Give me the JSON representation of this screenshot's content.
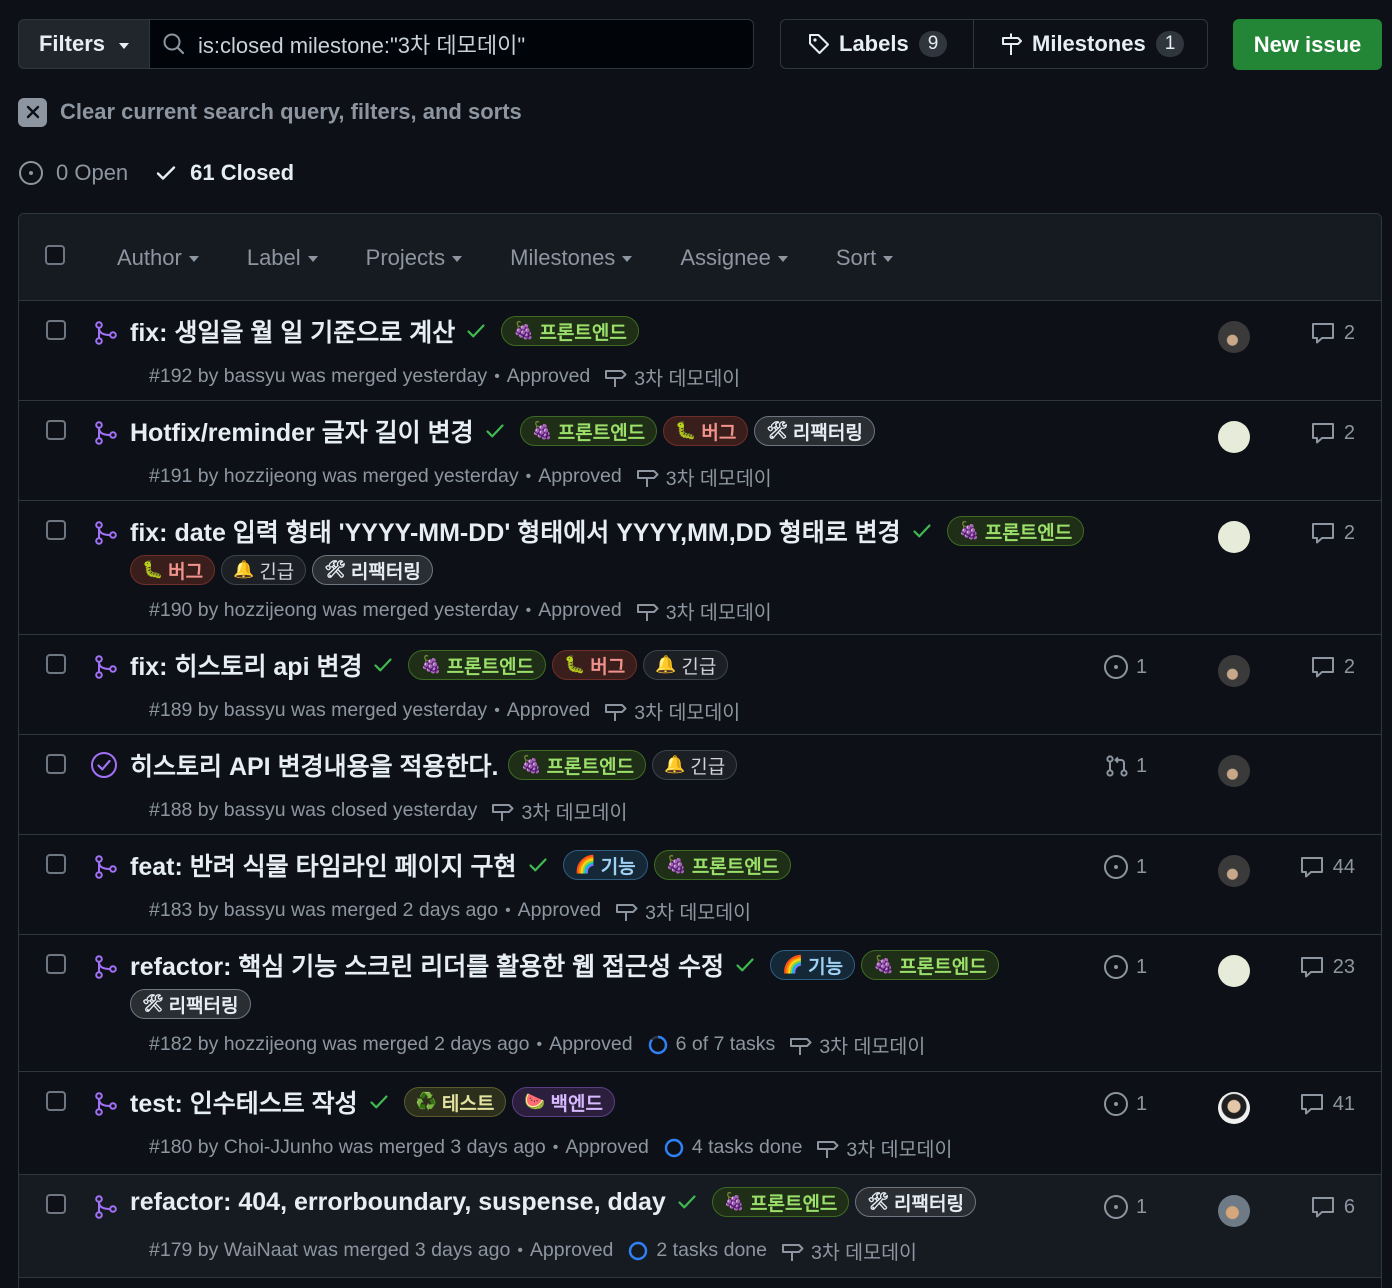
{
  "toolbar": {
    "filters_label": "Filters",
    "search_value": "is:closed milestone:\"3차 데모데이\"",
    "labels_label": "Labels",
    "labels_count": "9",
    "milestones_label": "Milestones",
    "milestones_count": "1",
    "new_issue_label": "New issue"
  },
  "clear_query_label": "Clear current search query, filters, and sorts",
  "states": {
    "open": "0 Open",
    "closed": "61 Closed"
  },
  "header_filters": [
    "Author",
    "Label",
    "Projects",
    "Milestones",
    "Assignee",
    "Sort"
  ],
  "colors": {
    "merged": "#a371f7",
    "accent_green": "#238636",
    "check_green": "#3fb950",
    "task_blue": "#2f81f7"
  },
  "items": [
    {
      "title": "fix: 생일을 월 일 기준으로 계산",
      "check": true,
      "labels": [
        {
          "emoji": "🍇",
          "text": "프론트엔드",
          "kind": "frontend"
        }
      ],
      "meta": "#192 by bassyu was merged yesterday",
      "review": "Approved",
      "tasks": "",
      "milestone": "3차 데모데이",
      "linked": "",
      "comments": "2",
      "icon": "merged-pr-icon",
      "avatar": "dark"
    },
    {
      "title": "Hotfix/reminder 글자 길이 변경",
      "check": true,
      "labels": [
        {
          "emoji": "🍇",
          "text": "프론트엔드",
          "kind": "frontend"
        },
        {
          "emoji": "🐛",
          "text": "버그",
          "kind": "bug"
        },
        {
          "emoji": "🛠",
          "text": "리팩터링",
          "kind": "refactor"
        }
      ],
      "meta": "#191 by hozzijeong was merged yesterday",
      "review": "Approved",
      "tasks": "",
      "milestone": "3차 데모데이",
      "linked": "",
      "comments": "2",
      "icon": "merged-pr-icon",
      "avatar": "identicon"
    },
    {
      "title": "fix: date 입력 형태 'YYYY-MM-DD' 형태에서 YYYY,MM,DD 형태로 변경",
      "check": true,
      "labels": [
        {
          "emoji": "🍇",
          "text": "프론트엔드",
          "kind": "frontend"
        },
        {
          "emoji": "🐛",
          "text": "버그",
          "kind": "bug"
        },
        {
          "emoji": "🔔",
          "text": "긴급",
          "kind": "urgent"
        },
        {
          "emoji": "🛠",
          "text": "리팩터링",
          "kind": "refactor"
        }
      ],
      "meta": "#190 by hozzijeong was merged yesterday",
      "review": "Approved",
      "tasks": "",
      "milestone": "3차 데모데이",
      "linked": "",
      "comments": "2",
      "icon": "merged-pr-icon",
      "avatar": "identicon"
    },
    {
      "title": "fix: 히스토리 api 변경",
      "check": true,
      "labels": [
        {
          "emoji": "🍇",
          "text": "프론트엔드",
          "kind": "frontend"
        },
        {
          "emoji": "🐛",
          "text": "버그",
          "kind": "bug"
        },
        {
          "emoji": "🔔",
          "text": "긴급",
          "kind": "urgent"
        }
      ],
      "meta": "#189 by bassyu was merged yesterday",
      "review": "Approved",
      "tasks": "",
      "milestone": "3차 데모데이",
      "linked": "1",
      "linked_kind": "issue",
      "comments": "2",
      "icon": "merged-pr-icon",
      "avatar": "dark"
    },
    {
      "title": "히스토리 API 변경내용을 적용한다.",
      "check": false,
      "labels": [
        {
          "emoji": "🍇",
          "text": "프론트엔드",
          "kind": "frontend"
        },
        {
          "emoji": "🔔",
          "text": "긴급",
          "kind": "urgent"
        }
      ],
      "meta": "#188 by bassyu was closed yesterday",
      "review": "",
      "tasks": "",
      "milestone": "3차 데모데이",
      "linked": "1",
      "linked_kind": "pr",
      "comments": "",
      "icon": "closed-issue-icon",
      "avatar": "dark"
    },
    {
      "title": "feat: 반려 식물 타임라인 페이지 구현",
      "check": true,
      "labels": [
        {
          "emoji": "🌈",
          "text": "기능",
          "kind": "feature"
        },
        {
          "emoji": "🍇",
          "text": "프론트엔드",
          "kind": "frontend"
        }
      ],
      "meta": "#183 by bassyu was merged 2 days ago",
      "review": "Approved",
      "tasks": "",
      "milestone": "3차 데모데이",
      "linked": "1",
      "linked_kind": "issue",
      "comments": "44",
      "icon": "merged-pr-icon",
      "avatar": "dark"
    },
    {
      "title": "refactor: 핵심 기능 스크린 리더를 활용한 웹 접근성 수정",
      "check": true,
      "labels": [
        {
          "emoji": "🌈",
          "text": "기능",
          "kind": "feature"
        },
        {
          "emoji": "🍇",
          "text": "프론트엔드",
          "kind": "frontend"
        },
        {
          "emoji": "🛠",
          "text": "리팩터링",
          "kind": "refactor"
        }
      ],
      "meta": "#182 by hozzijeong was merged 2 days ago",
      "review": "Approved",
      "tasks": "6 of 7 tasks",
      "tasks_progress": 0.857,
      "milestone": "3차 데모데이",
      "linked": "1",
      "linked_kind": "issue",
      "comments": "23",
      "icon": "merged-pr-icon",
      "avatar": "identicon"
    },
    {
      "title": "test: 인수테스트 작성",
      "check": true,
      "labels": [
        {
          "emoji": "♻️",
          "text": "테스트",
          "kind": "test"
        },
        {
          "emoji": "🍉",
          "text": "백엔드",
          "kind": "backend"
        }
      ],
      "meta": "#180 by Choi-JJunho was merged 3 days ago",
      "review": "Approved",
      "tasks": "4 tasks done",
      "tasks_progress": 1,
      "milestone": "3차 데모데이",
      "linked": "1",
      "linked_kind": "issue",
      "comments": "41",
      "icon": "merged-pr-icon",
      "avatar": "choi"
    },
    {
      "title": "refactor: 404, errorboundary, suspense, dday",
      "check": true,
      "labels": [
        {
          "emoji": "🍇",
          "text": "프론트엔드",
          "kind": "frontend"
        },
        {
          "emoji": "🛠",
          "text": "리팩터링",
          "kind": "refactor"
        }
      ],
      "meta": "#179 by WaiNaat was merged 3 days ago",
      "review": "Approved",
      "tasks": "2 tasks done",
      "tasks_progress": 1,
      "milestone": "3차 데모데이",
      "linked": "1",
      "linked_kind": "issue",
      "comments": "6",
      "icon": "merged-pr-icon",
      "avatar": "wai"
    }
  ]
}
